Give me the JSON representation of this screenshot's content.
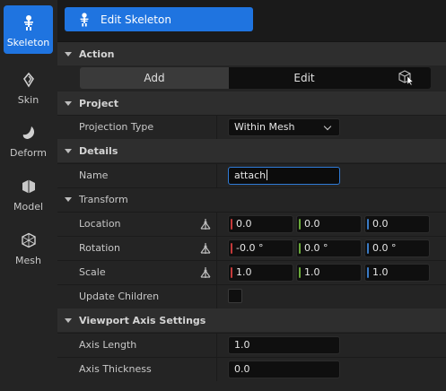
{
  "modes": [
    {
      "label": "Skeleton",
      "icon": "skeleton-icon",
      "active": true
    },
    {
      "label": "Skin",
      "icon": "skin-icon",
      "active": false
    },
    {
      "label": "Deform",
      "icon": "deform-icon",
      "active": false
    },
    {
      "label": "Model",
      "icon": "model-icon",
      "active": false
    },
    {
      "label": "Mesh",
      "icon": "mesh-icon",
      "active": false
    }
  ],
  "tool_button": {
    "label": "Edit Skeleton",
    "icon": "skeleton-icon"
  },
  "sections": {
    "action": {
      "title": "Action",
      "add_label": "Add",
      "edit_label": "Edit",
      "extra_icon": "select-cube-cursor-icon"
    },
    "project": {
      "title": "Project",
      "projection_type_label": "Projection Type",
      "projection_type_value": "Within Mesh"
    },
    "details": {
      "title": "Details",
      "name_label": "Name",
      "name_value": "attach",
      "transform_title": "Transform",
      "location_label": "Location",
      "location": {
        "x": "0.0",
        "y": "0.0",
        "z": "0.0"
      },
      "rotation_label": "Rotation",
      "rotation": {
        "x": "-0.0 °",
        "y": "0.0 °",
        "z": "0.0 °"
      },
      "scale_label": "Scale",
      "scale": {
        "x": "1.0",
        "y": "1.0",
        "z": "1.0"
      },
      "update_children_label": "Update Children",
      "update_children_checked": false
    },
    "viewport": {
      "title": "Viewport Axis Settings",
      "axis_length_label": "Axis Length",
      "axis_length_value": "1.0",
      "axis_thickness_label": "Axis Thickness",
      "axis_thickness_value": "0.0"
    }
  },
  "colors": {
    "accent": "#1f74e0",
    "axis_x": "#c43a3a",
    "axis_y": "#6aaa3a",
    "axis_z": "#3a7ac4"
  }
}
